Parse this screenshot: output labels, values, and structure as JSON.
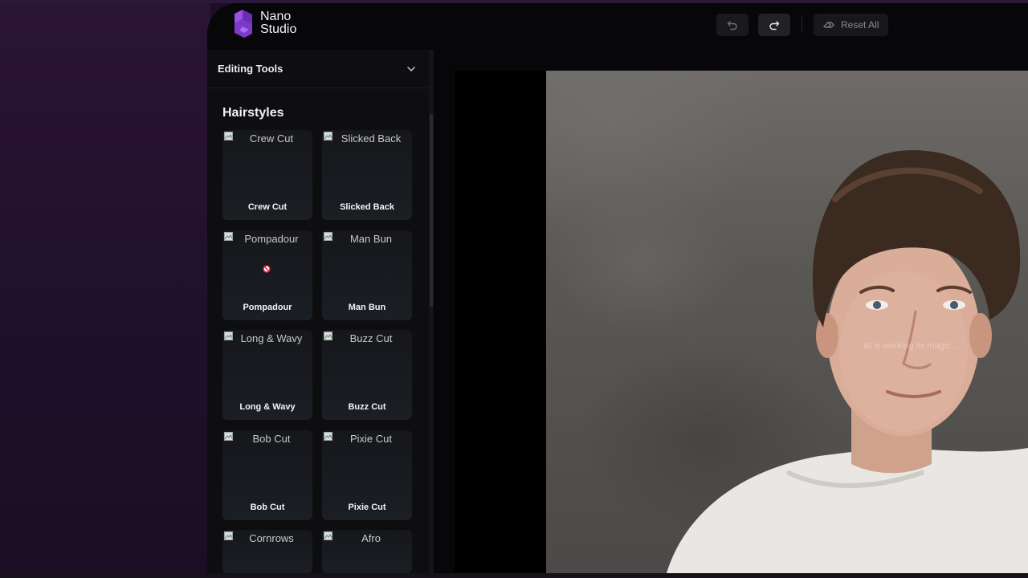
{
  "app": {
    "logo_line1": "Nano",
    "logo_line2": "Studio",
    "accent_color": "#8b3fd9"
  },
  "toolbar": {
    "undo_icon": "undo-icon",
    "redo_icon": "redo-icon",
    "reset_label": "Reset All"
  },
  "sidebar": {
    "editing_tools_label": "Editing Tools",
    "section_title": "Hairstyles",
    "hairstyles": [
      {
        "alt": "Crew Cut",
        "caption": "Crew Cut"
      },
      {
        "alt": "Slicked Back",
        "caption": "Slicked Back"
      },
      {
        "alt": "Pompadour",
        "caption": "Pompadour"
      },
      {
        "alt": "Man Bun",
        "caption": "Man Bun"
      },
      {
        "alt": "Long & Wavy",
        "caption": "Long & Wavy"
      },
      {
        "alt": "Buzz Cut",
        "caption": "Buzz Cut"
      },
      {
        "alt": "Bob Cut",
        "caption": "Bob Cut"
      },
      {
        "alt": "Pixie Cut",
        "caption": "Pixie Cut"
      },
      {
        "alt": "Cornrows",
        "caption": ""
      },
      {
        "alt": "Afro",
        "caption": ""
      }
    ]
  },
  "canvas": {
    "overlay_text": "AI is working its magic..."
  }
}
